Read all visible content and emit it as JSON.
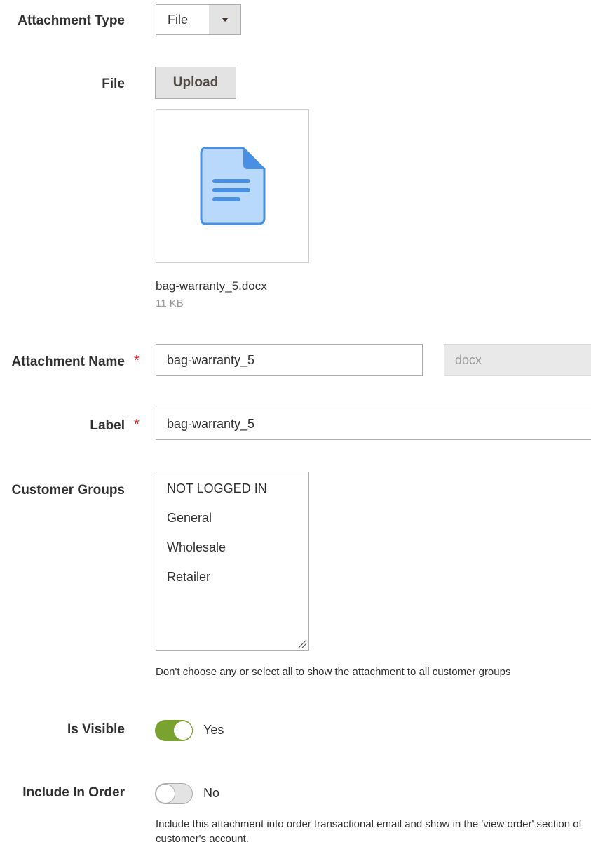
{
  "attachment_type": {
    "label": "Attachment Type",
    "value": "File"
  },
  "file": {
    "label": "File",
    "upload_label": "Upload",
    "preview_icon": "document-icon",
    "name": "bag-warranty_5.docx",
    "size": "11 KB"
  },
  "attachment_name": {
    "label": "Attachment Name",
    "required_mark": "*",
    "value": "bag-warranty_5",
    "extension": "docx"
  },
  "label_field": {
    "label": "Label",
    "required_mark": "*",
    "value": "bag-warranty_5"
  },
  "customer_groups": {
    "label": "Customer Groups",
    "options": [
      "NOT LOGGED IN",
      "General",
      "Wholesale",
      "Retailer"
    ],
    "note": "Don't choose any or select all to show the attachment to all customer groups"
  },
  "is_visible": {
    "label": "Is Visible",
    "state": true,
    "state_text": "Yes"
  },
  "include_in_order": {
    "label": "Include In Order",
    "state": false,
    "state_text": "No",
    "note": "Include this attachment into order transactional email and show in the 'view order' section of customer's account."
  },
  "colors": {
    "toggle_on": "#79a22e",
    "required": "#e22626",
    "file_icon": "#4a90e2"
  }
}
